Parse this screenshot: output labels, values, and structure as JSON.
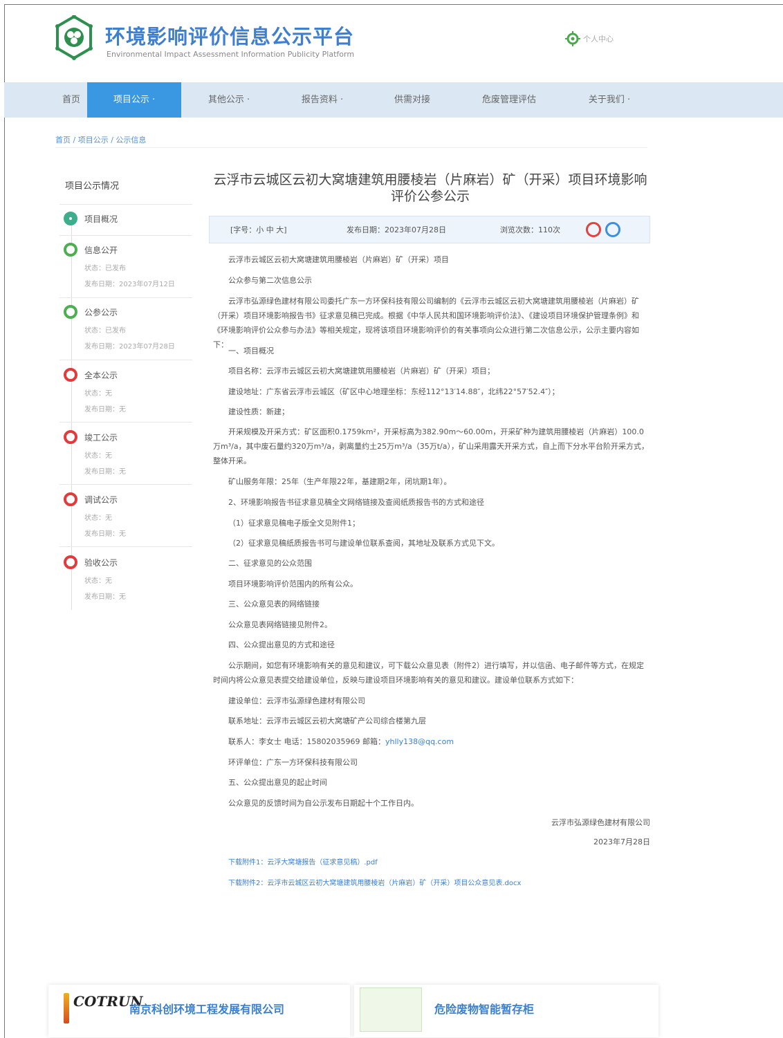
{
  "header": {
    "title": "环境影响评价信息公示平台",
    "subtitle": "Environmental Impact Assessment Information Publicity Platform",
    "personal_center": "个人中心",
    "logo_icon": "leaf-emblem-icon"
  },
  "nav": [
    {
      "label": "首页",
      "active": false
    },
    {
      "label": "项目公示 ·",
      "active": true
    },
    {
      "label": "其他公示 ·",
      "active": false
    },
    {
      "label": "报告资料 ·",
      "active": false
    },
    {
      "label": "供需对接",
      "active": false
    },
    {
      "label": "危废管理评估",
      "active": false
    },
    {
      "label": "关于我们 ·",
      "active": false
    }
  ],
  "breadcrumb": "首页 / 项目公示 / 公示信息",
  "sidebar": {
    "title": "项目公示情况",
    "steps": [
      {
        "label": "项目概况",
        "status": "done",
        "meta": []
      },
      {
        "label": "信息公开",
        "status": "done",
        "meta": [
          "状态：已发布",
          "发布日期：2023年07月12日"
        ]
      },
      {
        "label": "公参公示",
        "status": "done",
        "meta": [
          "状态：已发布",
          "发布日期：2023年07月28日"
        ]
      },
      {
        "label": "全本公示",
        "status": "pending",
        "meta": [
          "状态：无",
          "发布日期：无"
        ]
      },
      {
        "label": "竣工公示",
        "status": "pending",
        "meta": [
          "状态：无",
          "发布日期：无"
        ]
      },
      {
        "label": "调试公示",
        "status": "pending",
        "meta": [
          "状态：无",
          "发布日期：无"
        ]
      },
      {
        "label": "验收公示",
        "status": "pending",
        "meta": [
          "状态：无",
          "发布日期：无"
        ]
      }
    ]
  },
  "article": {
    "title": "云浮市云城区云初大窝塘建筑用腰棱岩（片麻岩）矿（开采）项目环境影响评价公参公示",
    "font_size": "[字号：小 中 大]",
    "publish_date": "发布日期：2023年07月28日",
    "views": "浏览次数：110次",
    "lines": {
      "l1": "云浮市云城区云初大窝塘建筑用腰棱岩（片麻岩）矿（开采）项目",
      "l2": "公众参与第二次信息公示",
      "l3": "云浮市弘源绿色建材有限公司委托广东一方环保科技有限公司编制的《云浮市云城区云初大窝塘建筑用腰棱岩（片麻岩）矿（开采）项目环境影响报告书》征求意见稿已完成。根据《中华人民共和国环境影响评价法》、《建设项目环境保护管理条例》和《环境影响评价公众参与办法》等相关规定，现将该项目环境影响评价的有关事项向公众进行第二次信息公示，公示主要内容如下：",
      "l4": "一、项目概况",
      "l5": "项目名称：云浮市云城区云初大窝塘建筑用腰棱岩（片麻岩）矿（开采）项目；",
      "l6": "建设地址：广东省云浮市云城区（矿区中心地理坐标：东经112°13′14.88″，北纬22°57′52.4″）；",
      "l7": "建设性质：新建；",
      "l8": "开采规模及开采方式：矿区面积0.1759km²，开采标高为382.90m～60.00m，开采矿种为建筑用腰棱岩（片麻岩）100.0万m³/a，其中废石量约320万m³/a，剥离量约土25万m³/a（35万t/a），矿山采用露天开采方式，自上而下分水平台阶开采方式，整体开采。",
      "l9": "矿山服务年限：25年（生产年限22年，基建期2年，闭坑期1年）。",
      "l10": "2、环境影响报告书征求意见稿全文网络链接及查阅纸质报告书的方式和途径",
      "l11": "（1）征求意见稿电子版全文见附件1；",
      "l12": "（2）征求意见稿纸质报告书可与建设单位联系查阅，其地址及联系方式见下文。",
      "l13": "二、征求意见的公众范围",
      "l14": "项目环境影响评价范围内的所有公众。",
      "l15": "三、公众意见表的网络链接",
      "l16": "公众意见表网络链接见附件2。",
      "l17": "四、公众提出意见的方式和途径",
      "l18": "公示期间，如您有环境影响有关的意见和建议，可下载公众意见表（附件2）进行填写，并以信函、电子邮件等方式，在规定时间内将公众意见表提交给建设单位，反映与建设项目环境影响有关的意见和建议。建设单位联系方式如下：",
      "l19": "建设单位：云浮市弘源绿色建材有限公司",
      "l20": "联系地址：云浮市云城区云初大窝塘矿产公司综合楼第九层",
      "l21_pre": "联系人：李女士 电话：15802035969 邮箱：",
      "l21_email": "yhlly138@qq.com",
      "l22": "环评单位：广东一方环保科技有限公司",
      "l23": "五、公众提出意见的起止时间",
      "l24": "公众意见的反馈时间为自公示发布日期起十个工作日内。",
      "sign_company": "云浮市弘源绿色建材有限公司",
      "sign_date": "2023年7月28日",
      "att1": "下载附件1：云浮大窝塘报告（征求意见稿）.pdf",
      "att2": "下载附件2：云浮市云城区云初大窝塘建筑用腰棱岩（片麻岩）矿（开采）项目公众意见表.docx"
    }
  },
  "footer": {
    "logo_text": "COTRUN",
    "company": "南京科创环境工程发展有限公司",
    "product": "危险废物智能暂存柜"
  }
}
